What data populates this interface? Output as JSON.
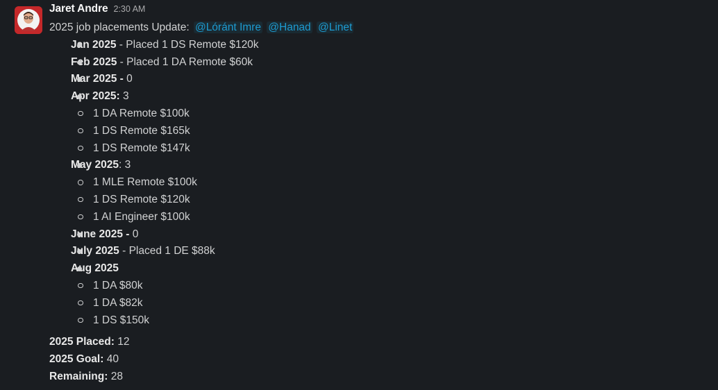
{
  "message": {
    "author": "Jaret Andre",
    "timestamp": "2:30 AM",
    "intro": "2025 job placements Update:",
    "mentions": [
      "@Lóránt Imre",
      "@Hanad",
      "@Linet"
    ],
    "months": [
      {
        "label": "Jan 2025",
        "sep": " - ",
        "text": "Placed 1 DS Remote $120k",
        "items": []
      },
      {
        "label": "Feb 2025",
        "sep": " - ",
        "text": "Placed 1 DA Remote $60k",
        "items": []
      },
      {
        "label": "Mar 2025 -",
        "sep": " ",
        "text": "0",
        "items": []
      },
      {
        "label": "Apr 2025:",
        "sep": " ",
        "text": "3",
        "items": [
          "1 DA Remote $100k",
          "1 DS Remote $165k",
          "1 DS Remote $147k"
        ]
      },
      {
        "label": "May 2025",
        "sep": ": ",
        "text": "3",
        "items": [
          "1 MLE Remote $100k",
          "1 DS Remote $120k",
          "1 AI Engineer $100k"
        ]
      },
      {
        "label": "June 2025 -",
        "sep": " ",
        "text": "0",
        "items": []
      },
      {
        "label": "July 2025",
        "sep": " - ",
        "text": "Placed 1 DE $88k",
        "items": []
      },
      {
        "label": "Aug 2025",
        "sep": "",
        "text": "",
        "items": [
          "1 DA $80k",
          "1 DA $82k",
          "1 DS $150k"
        ]
      }
    ],
    "summary": {
      "placed_label": "2025 Placed:",
      "placed_value": "12",
      "goal_label": "2025 Goal:",
      "goal_value": "40",
      "remaining_label": "Remaining:",
      "remaining_value": "28"
    }
  }
}
